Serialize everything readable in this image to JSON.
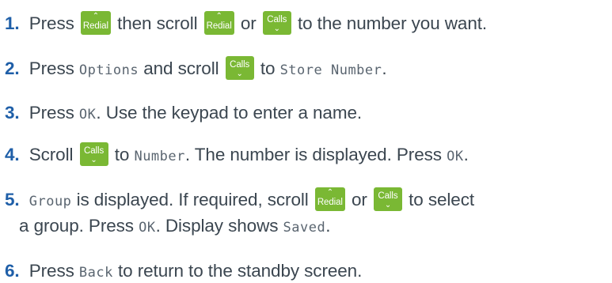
{
  "keys": {
    "redial": {
      "label": "Redial",
      "icon": "chevron-up-icon",
      "color": "#7ab834"
    },
    "calls": {
      "label": "Calls",
      "icon": "chevron-down-icon",
      "color": "#7ab834"
    }
  },
  "steps": [
    {
      "num": "1",
      "a": "Press",
      "b": "then scroll",
      "c": "or",
      "d": "to the number you want."
    },
    {
      "num": "2",
      "a": "Press",
      "lcd1": "Options",
      "b": "and scroll",
      "c": "to",
      "lcd2": "Store Number",
      "d": "."
    },
    {
      "num": "3",
      "a": "Press",
      "lcd1": "OK",
      "b": ". Use the keypad to enter a name."
    },
    {
      "num": "4",
      "a": "Scroll",
      "b": "to",
      "lcd1": "Number",
      "c": ". The number is displayed. Press",
      "lcd2": "OK",
      "d": "."
    },
    {
      "num": "5",
      "lcd1": "Group",
      "a": "is displayed. If required, scroll",
      "b": "or",
      "c": "to select",
      "line2a": "a group. Press",
      "lcd2": "OK",
      "line2b": ". Display shows",
      "lcd3": "Saved",
      "line2c": "."
    },
    {
      "num": "6",
      "a": "Press",
      "lcd1": "Back",
      "b": "to return to the standby screen."
    }
  ]
}
